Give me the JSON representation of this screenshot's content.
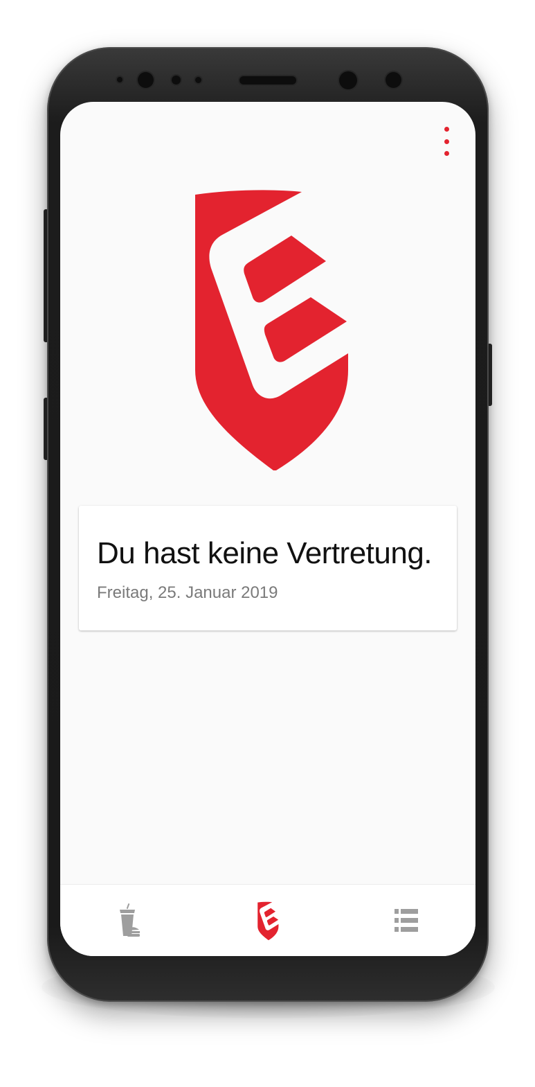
{
  "app": {
    "brand_color": "#e3232f",
    "menu_icon": "overflow-menu-icon"
  },
  "status_card": {
    "title": "Du hast keine Vertretung.",
    "date": "Freitag, 25. Januar 2019"
  },
  "bottom_nav": {
    "items": [
      {
        "icon": "food-drink-icon",
        "active": false
      },
      {
        "icon": "logo-shield-icon",
        "active": true
      },
      {
        "icon": "list-icon",
        "active": false
      }
    ],
    "inactive_color": "#9e9e9e",
    "active_color": "#e3232f"
  }
}
